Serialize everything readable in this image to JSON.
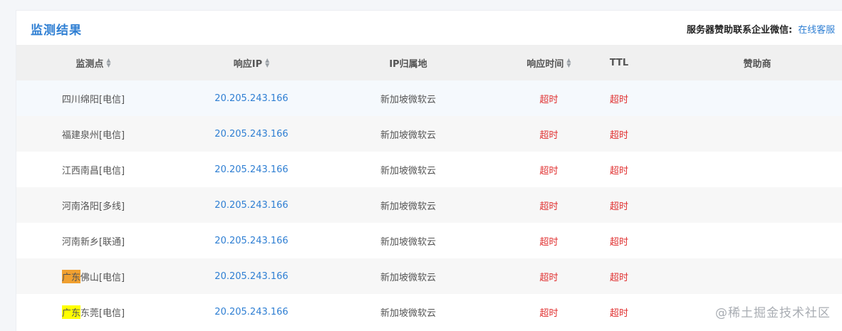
{
  "header": {
    "title": "监测结果",
    "sponsor_label": "服务器赞助联系企业微信:",
    "sponsor_link": "在线客服"
  },
  "columns": {
    "point": "监测点",
    "ip": "响应IP",
    "location": "IP归属地",
    "time": "响应时间",
    "ttl": "TTL",
    "sponsor": "赞助商"
  },
  "rows": [
    {
      "point_hl": "",
      "point_rest": "四川绵阳[电信]",
      "ip": "20.205.243.166",
      "location": "新加坡微软云",
      "time": "超时",
      "ttl": "超时"
    },
    {
      "point_hl": "",
      "point_rest": "福建泉州[电信]",
      "ip": "20.205.243.166",
      "location": "新加坡微软云",
      "time": "超时",
      "ttl": "超时"
    },
    {
      "point_hl": "",
      "point_rest": "江西南昌[电信]",
      "ip": "20.205.243.166",
      "location": "新加坡微软云",
      "time": "超时",
      "ttl": "超时"
    },
    {
      "point_hl": "",
      "point_rest": "河南洛阳[多线]",
      "ip": "20.205.243.166",
      "location": "新加坡微软云",
      "time": "超时",
      "ttl": "超时"
    },
    {
      "point_hl": "",
      "point_rest": "河南新乡[联通]",
      "ip": "20.205.243.166",
      "location": "新加坡微软云",
      "time": "超时",
      "ttl": "超时"
    },
    {
      "point_hl": "广东",
      "point_rest": "佛山[电信]",
      "ip": "20.205.243.166",
      "location": "新加坡微软云",
      "time": "超时",
      "ttl": "超时"
    },
    {
      "point_hl": "广东",
      "point_rest": "东莞[电信]",
      "ip": "20.205.243.166",
      "location": "新加坡微软云",
      "time": "超时",
      "ttl": "超时"
    }
  ],
  "highlight_colors": {
    "row6": "#f0a030",
    "row7": "#ffff00"
  },
  "watermark": "@稀土掘金技术社区"
}
